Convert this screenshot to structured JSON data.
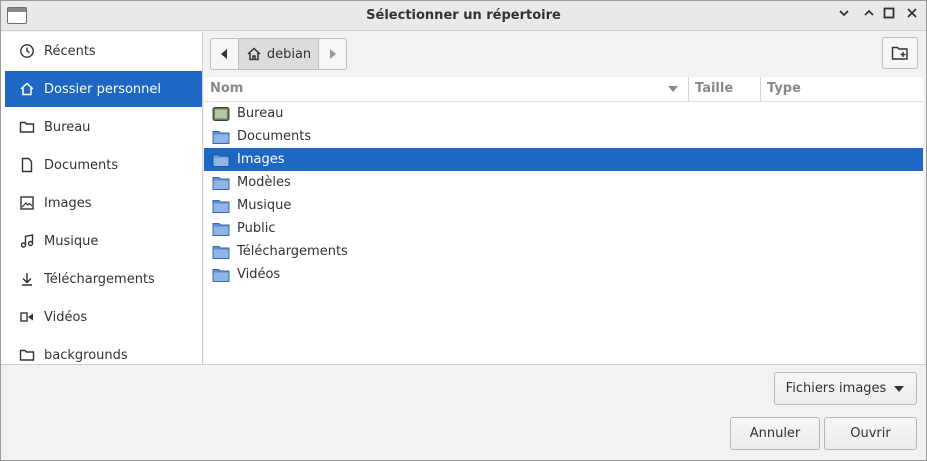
{
  "window": {
    "title": "Sélectionner un répertoire",
    "controls": {
      "minimize": "⌃",
      "maximize": "□",
      "close": "✕"
    }
  },
  "sidebar": {
    "items": [
      {
        "label": "Récents",
        "icon": "clock-icon",
        "active": false
      },
      {
        "label": "Dossier personnel",
        "icon": "home-icon",
        "active": true
      },
      {
        "label": "Bureau",
        "icon": "folder-icon",
        "active": false
      },
      {
        "label": "Documents",
        "icon": "document-icon",
        "active": false
      },
      {
        "label": "Images",
        "icon": "image-icon",
        "active": false
      },
      {
        "label": "Musique",
        "icon": "music-icon",
        "active": false
      },
      {
        "label": "Téléchargements",
        "icon": "download-icon",
        "active": false
      },
      {
        "label": "Vidéos",
        "icon": "video-icon",
        "active": false
      },
      {
        "label": "backgrounds",
        "icon": "folder-icon",
        "active": false
      }
    ]
  },
  "pathbar": {
    "crumb": "debian"
  },
  "filelist": {
    "columns": {
      "name": "Nom",
      "size": "Taille",
      "type": "Type"
    },
    "rows": [
      {
        "name": "Bureau",
        "icon": "desktop-folder-icon",
        "selected": false
      },
      {
        "name": "Documents",
        "icon": "folder-icon",
        "selected": false
      },
      {
        "name": "Images",
        "icon": "folder-icon",
        "selected": true
      },
      {
        "name": "Modèles",
        "icon": "folder-icon",
        "selected": false
      },
      {
        "name": "Musique",
        "icon": "folder-icon",
        "selected": false
      },
      {
        "name": "Public",
        "icon": "folder-icon",
        "selected": false
      },
      {
        "name": "Téléchargements",
        "icon": "folder-icon",
        "selected": false
      },
      {
        "name": "Vidéos",
        "icon": "folder-icon",
        "selected": false
      }
    ]
  },
  "footer": {
    "filter": "Fichiers images",
    "cancel": "Annuler",
    "open": "Ouvrir"
  },
  "colors": {
    "accent": "#1f67c4",
    "folder": "#5b8fd0"
  }
}
